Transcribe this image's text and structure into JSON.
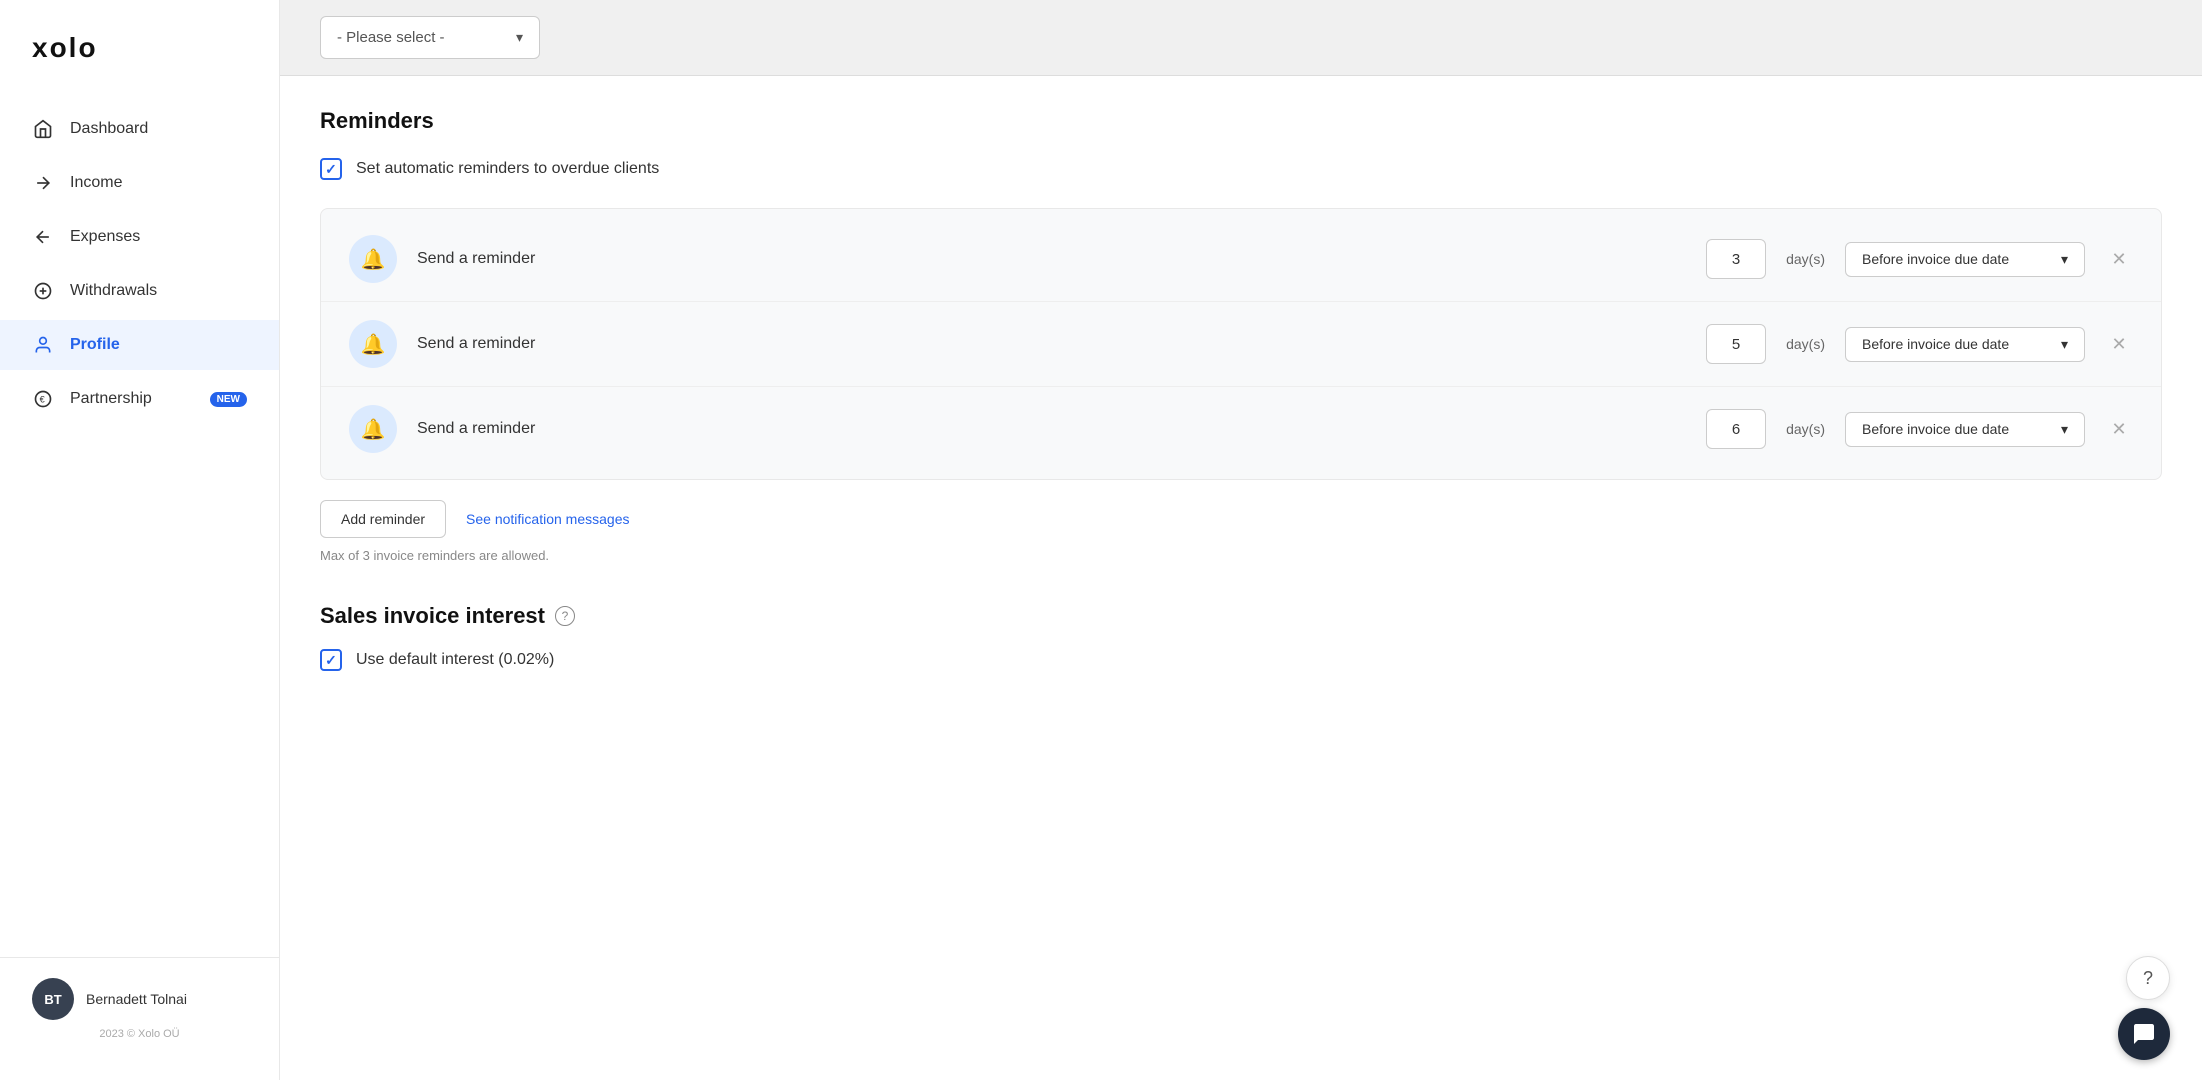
{
  "sidebar": {
    "logo": "xolo",
    "items": [
      {
        "id": "dashboard",
        "label": "Dashboard",
        "icon": "dashboard",
        "active": false
      },
      {
        "id": "income",
        "label": "Income",
        "icon": "arrow-right",
        "active": false
      },
      {
        "id": "expenses",
        "label": "Expenses",
        "icon": "arrow-left",
        "active": false
      },
      {
        "id": "withdrawals",
        "label": "Withdrawals",
        "icon": "circle",
        "active": false
      },
      {
        "id": "profile",
        "label": "Profile",
        "icon": "person",
        "active": true
      },
      {
        "id": "partnership",
        "label": "Partnership",
        "icon": "euro",
        "active": false,
        "badge": "NEW"
      }
    ],
    "user": {
      "initials": "BT",
      "name": "Bernadett Tolnai"
    },
    "copyright": "2023 © Xolo OÜ"
  },
  "topbar": {
    "select_placeholder": "- Please select -"
  },
  "reminders": {
    "section_title": "Reminders",
    "auto_reminder_label": "Set automatic reminders to overdue clients",
    "auto_reminder_checked": true,
    "rows": [
      {
        "label": "Send a reminder",
        "days": "3",
        "timing": "Before invoice due date"
      },
      {
        "label": "Send a reminder",
        "days": "5",
        "timing": "Before invoice due date"
      },
      {
        "label": "Send a reminder",
        "days": "6",
        "timing": "Before invoice due date"
      }
    ],
    "days_unit": "day(s)",
    "add_button_label": "Add reminder",
    "notifications_link": "See notification messages",
    "max_note": "Max of 3 invoice reminders are allowed."
  },
  "sales_interest": {
    "section_title": "Sales invoice interest",
    "default_interest_label": "Use default interest (0.02%)",
    "default_interest_checked": true
  },
  "help": {
    "fab_label": "?",
    "chat_label": "chat"
  }
}
